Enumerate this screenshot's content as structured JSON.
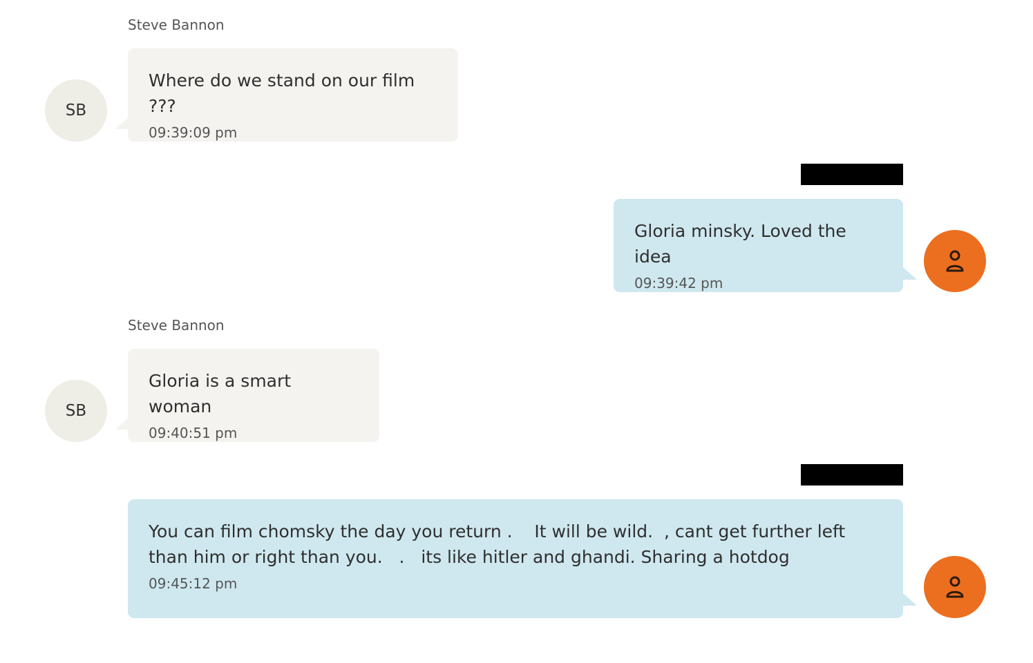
{
  "messages": [
    {
      "direction": "incoming",
      "sender": "Steve Bannon",
      "initials": "SB",
      "text": "Where do we stand on our film ???",
      "time": "09:39:09 pm"
    },
    {
      "direction": "outgoing",
      "sender_redacted": true,
      "avatar_icon": "user-icon",
      "text": "Gloria minsky. Loved the idea",
      "time": "09:39:42 pm"
    },
    {
      "direction": "incoming",
      "sender": "Steve Bannon",
      "initials": "SB",
      "text": "Gloria is a smart woman",
      "time": "09:40:51 pm"
    },
    {
      "direction": "outgoing",
      "sender_redacted": true,
      "avatar_icon": "user-icon",
      "text": "You can film chomsky the day you return .    It will be wild.  , cant get further left than him or right than you.   .   its like hitler and ghandi. Sharing a hotdog",
      "time": "09:45:12 pm"
    }
  ],
  "colors": {
    "incoming_bubble": "#f4f3f0",
    "outgoing_bubble": "#cfe8ef",
    "initials_avatar": "#eeede6",
    "user_avatar": "#ec6e1f",
    "redaction": "#000000"
  }
}
